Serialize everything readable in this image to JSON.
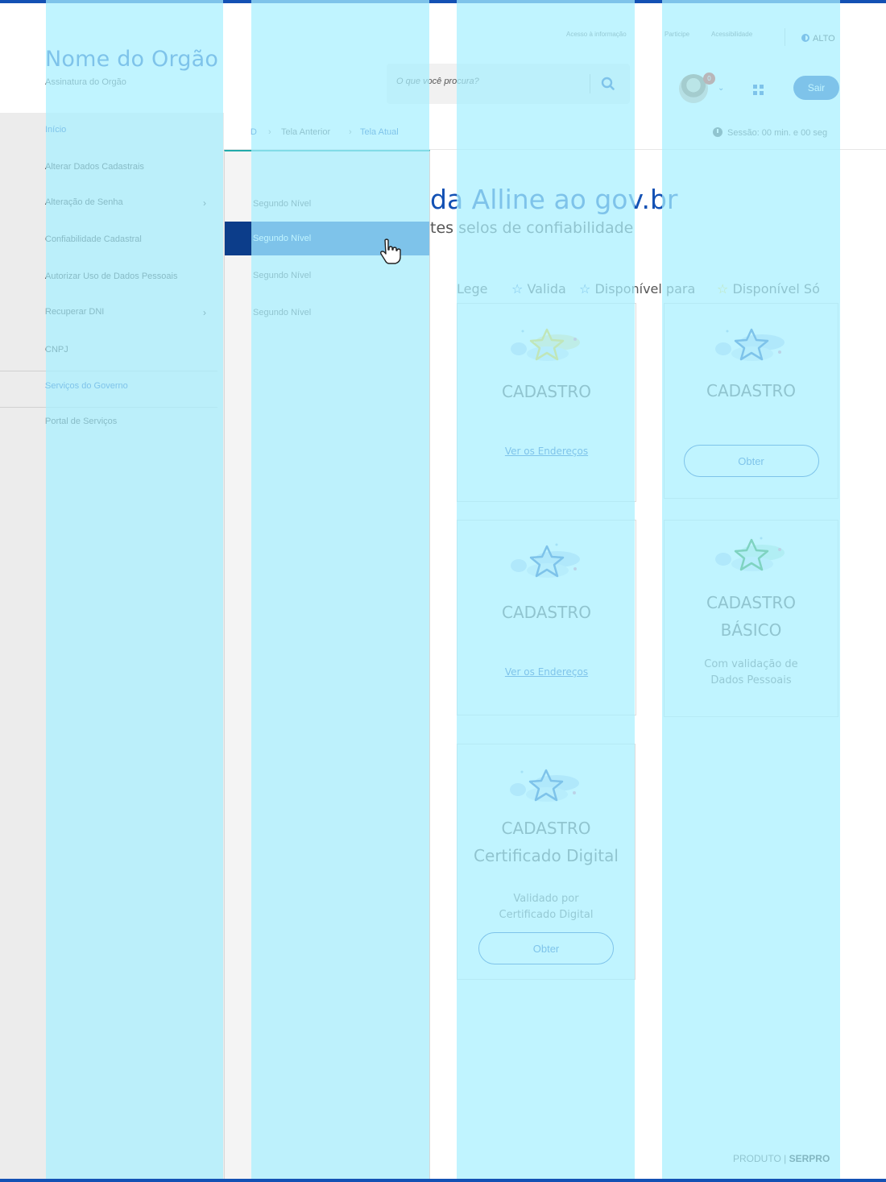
{
  "header": {
    "org_name": "Nome do Orgão",
    "org_signature": "Assinatura do Orgão",
    "top_links": [
      "Acesso à informação",
      "Participe",
      "Acessibilidade"
    ],
    "contrast_label": "ALTO",
    "search_placeholder": "O que você procura?",
    "notification_count": "0",
    "logout_label": "Sair"
  },
  "breadcrumb": {
    "home": "D",
    "previous": "Tela Anterior",
    "current": "Tela Atual",
    "separator": "›"
  },
  "session": {
    "label": "Sessão: 00 min. e 00 seg"
  },
  "side_menu": {
    "items": [
      {
        "label": "Início",
        "active": true
      },
      {
        "label": "Alterar Dados Cadastrais"
      },
      {
        "label": "Alteração de Senha",
        "chevron": "›"
      },
      {
        "label": "Confiabilidade Cadastral"
      },
      {
        "label": "Autorizar Uso de Dados Pessoais"
      },
      {
        "label": "Recuperar DNI",
        "chevron": "›"
      },
      {
        "label": "CNPJ"
      },
      {
        "label": "Serviços do Governo",
        "active": true
      },
      {
        "label": "Portal de Serviços"
      }
    ]
  },
  "submenu": {
    "items": [
      {
        "label": "Segundo Nível"
      },
      {
        "label": "Segundo Nível",
        "selected": true
      },
      {
        "label": "Segundo Nível"
      },
      {
        "label": "Segundo Nível"
      }
    ]
  },
  "main": {
    "title_plain": "da ",
    "title_blue": "Alline ao gov.br",
    "subtitle": "tes selos de confiabilidade",
    "legend": [
      "Lege",
      "Valida",
      "Disponível para",
      "Disponível Só"
    ]
  },
  "cards": [
    {
      "title": "CADASTRO",
      "link": "Ver os Endereços"
    },
    {
      "title": "CADASTRO",
      "button": "Obter"
    },
    {
      "title": "CADASTRO",
      "link": "Ver os Endereços"
    },
    {
      "title_line1": "CADASTRO",
      "title_line2": "BÁSICO",
      "desc_line1": "Com validação de",
      "desc_line2": "Dados Pessoais"
    },
    {
      "title_line1": "CADASTRO",
      "title_line2": "Certificado Digital",
      "desc_line1": "Validado por",
      "desc_line2": "Certificado Digital",
      "button": "Obter"
    }
  ],
  "footer": {
    "produto": "PRODUTO",
    "separator": "|",
    "brand": "SERPRO"
  },
  "colors": {
    "primary": "#1351b4",
    "overlay": "#a8f0ff",
    "menu_bg": "#ececec",
    "star_gold": "#ffcd07"
  },
  "icons": [
    "search-icon",
    "clock-icon",
    "apps-grid-icon",
    "chevron-down-icon",
    "star-icon",
    "hand-cursor-icon",
    "contrast-icon"
  ]
}
